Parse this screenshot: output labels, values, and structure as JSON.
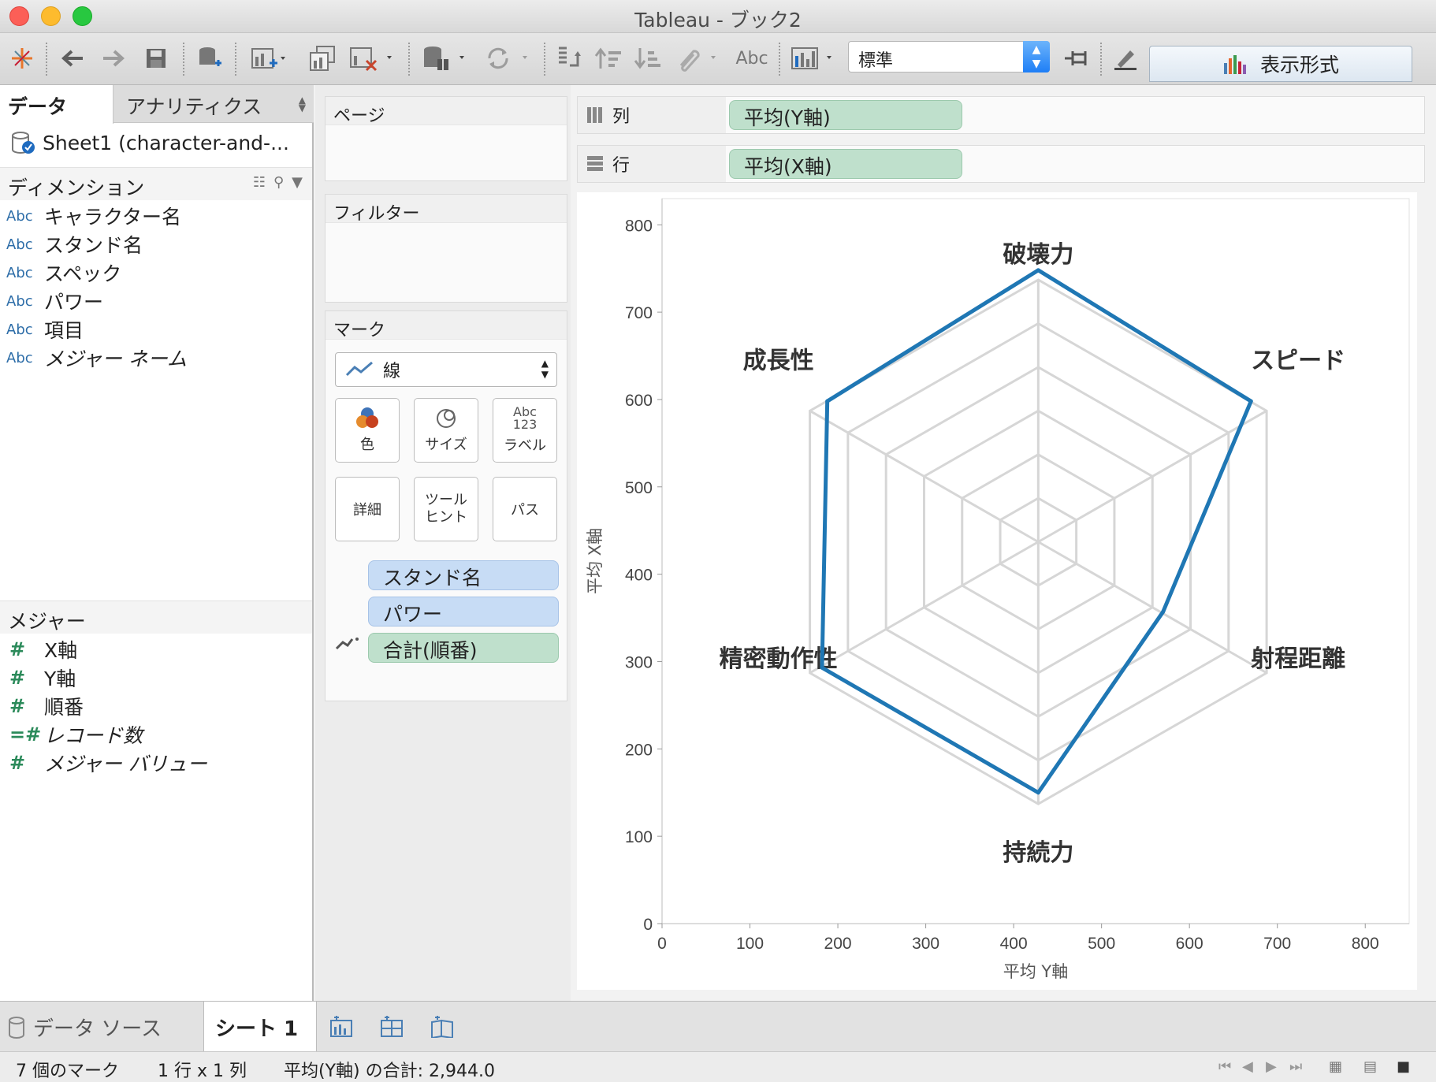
{
  "window": {
    "title": "Tableau - ブック2"
  },
  "toolbar": {
    "fit_select": "標準",
    "abc_label": "Abc",
    "show_me": "表示形式"
  },
  "data_pane": {
    "tabs": [
      "データ",
      "アナリティクス"
    ],
    "source": "Sheet1 (character-and-...",
    "dimensions_header": "ディメンション",
    "dimensions": [
      {
        "type": "Abc",
        "name": "キャラクター名"
      },
      {
        "type": "Abc",
        "name": "スタンド名"
      },
      {
        "type": "Abc",
        "name": "スペック"
      },
      {
        "type": "Abc",
        "name": "パワー"
      },
      {
        "type": "Abc",
        "name": "項目"
      },
      {
        "type": "Abc",
        "name": "メジャー ネーム"
      }
    ],
    "measures_header": "メジャー",
    "measures": [
      {
        "type": "#",
        "name": "X軸"
      },
      {
        "type": "#",
        "name": "Y軸"
      },
      {
        "type": "#",
        "name": "順番"
      },
      {
        "type": "=#",
        "name": "レコード数"
      },
      {
        "type": "#",
        "name": "メジャー バリュー"
      }
    ]
  },
  "cards": {
    "pages": "ページ",
    "filters": "フィルター",
    "marks": "マーク",
    "mark_type": "線",
    "buttons": [
      {
        "label": "色",
        "icon": "color-icon"
      },
      {
        "label": "サイズ",
        "icon": "size-icon"
      },
      {
        "label": "ラベル",
        "icon": "label-icon",
        "glyph1": "Abc",
        "glyph2": "123"
      },
      {
        "label": "詳細",
        "icon": ""
      },
      {
        "label": "ツール\nヒント",
        "icon": ""
      },
      {
        "label": "パス",
        "icon": ""
      }
    ],
    "pills": [
      "スタンド名",
      "パワー",
      "合計(順番)"
    ]
  },
  "shelves": {
    "columns_label": "列",
    "columns_pill": "平均(Y軸)",
    "rows_label": "行",
    "rows_pill": "平均(X軸)"
  },
  "chart_data": {
    "type": "line",
    "xlabel": "平均 Y軸",
    "ylabel": "平均 X軸",
    "xlim": [
      0,
      850
    ],
    "ylim": [
      0,
      830
    ],
    "x_ticks": [
      0,
      100,
      200,
      300,
      400,
      500,
      600,
      700,
      800
    ],
    "y_ticks": [
      0,
      100,
      200,
      300,
      400,
      500,
      600,
      700,
      800
    ],
    "radar_center": [
      428,
      437
    ],
    "radar_levels": [
      50,
      100,
      150,
      200,
      250,
      300
    ],
    "axis_labels": [
      "破壊力",
      "スピード",
      "射程距離",
      "持続力",
      "精密動作性",
      "成長性"
    ],
    "series": [
      {
        "x": [
          428,
          670,
          570,
          428,
          182,
          188,
          428
        ],
        "y": [
          748,
          598,
          357,
          150,
          293,
          598,
          748
        ]
      }
    ],
    "colors": {
      "line": "#1f77b4",
      "grid": "#d6d6d6"
    }
  },
  "sheets": {
    "datasource_tab": "データ ソース",
    "active_sheet": "シート 1"
  },
  "status": {
    "marks": "7 個のマーク",
    "grid": "1 行 x 1 列",
    "sum": "平均(Y軸) の合計: 2,944.0"
  }
}
